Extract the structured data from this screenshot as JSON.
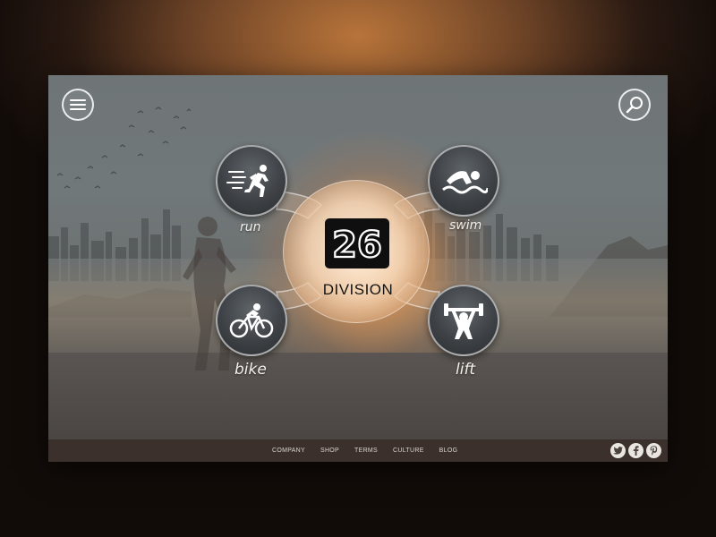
{
  "brand": {
    "logo_numeral": "26",
    "logo_text": "DIVISION"
  },
  "header": {
    "menu_icon": "hamburger-menu-icon",
    "search_icon": "search-icon"
  },
  "activities": [
    {
      "label": "run",
      "icon": "running-person-icon"
    },
    {
      "label": "swim",
      "icon": "swimmer-icon"
    },
    {
      "label": "bike",
      "icon": "cyclist-icon"
    },
    {
      "label": "lift",
      "icon": "weightlifter-icon"
    }
  ],
  "footer": {
    "links": [
      "COMPANY",
      "SHOP",
      "TERMS",
      "CULTURE",
      "BLOG"
    ],
    "social": [
      "twitter-icon",
      "facebook-icon",
      "pinterest-icon"
    ]
  },
  "colors": {
    "accent_glow": "#f2c79a",
    "circle_dark": "#3e4246",
    "footer_bg": "#3a2e2a"
  }
}
